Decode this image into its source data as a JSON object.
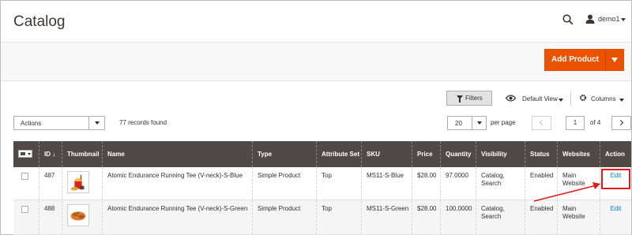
{
  "header": {
    "title": "Catalog",
    "user_name": "demo1"
  },
  "actions_bar": {
    "add_product_label": "Add Product"
  },
  "toolbar": {
    "filters_label": "Filters",
    "view_label": "Default View",
    "columns_label": "Columns",
    "actions_label": "Actions",
    "records_found": "77 records found",
    "per_page_value": "20",
    "per_page_label": "per page",
    "current_page": "1",
    "page_of": "of 4"
  },
  "grid": {
    "columns": {
      "id": "ID ↓",
      "thumbnail": "Thumbnail",
      "name": "Name",
      "type": "Type",
      "attribute_set": "Attribute Set",
      "sku": "SKU",
      "price": "Price",
      "quantity": "Quantity",
      "visibility": "Visibility",
      "status": "Status",
      "websites": "Websites",
      "action": "Action"
    },
    "rows": [
      {
        "id": "487",
        "name": "Atomic Endurance Running Tee (V-neck)-S-Blue",
        "type": "Simple Product",
        "attribute_set": "Top",
        "sku": "MS11-S-Blue",
        "price": "$28.00",
        "quantity": "97.0000",
        "visibility": "Catalog, Search",
        "status": "Enabled",
        "websites": "Main Website",
        "action": "Edit"
      },
      {
        "id": "488",
        "name": "Atomic Endurance Running Tee (V-neck)-S-Green",
        "type": "Simple Product",
        "attribute_set": "Top",
        "sku": "MS11-S-Green",
        "price": "$28.00",
        "quantity": "100.0000",
        "visibility": "Catalog, Search",
        "status": "Enabled",
        "websites": "Main Website",
        "action": "Edit"
      }
    ]
  },
  "colors": {
    "accent": "#eb5202",
    "grid_header": "#514943",
    "link": "#007bdb",
    "annotation": "#e41b1b"
  }
}
